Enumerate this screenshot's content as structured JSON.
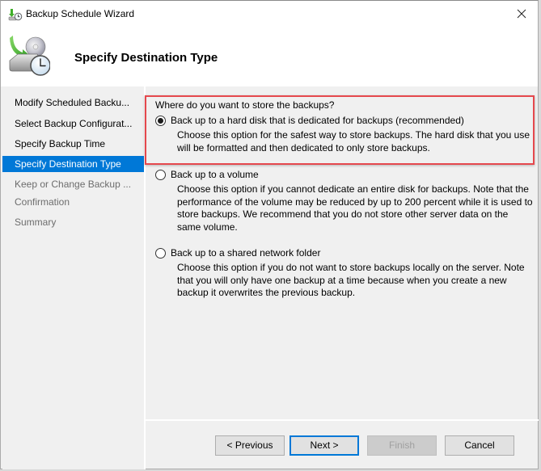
{
  "window": {
    "title": "Backup Schedule Wizard",
    "title_icon": "backup-schedule-icon",
    "close_icon": "close-icon"
  },
  "header": {
    "title": "Specify Destination Type",
    "icon": "backup-disk-clock-icon"
  },
  "sidebar": {
    "items": [
      {
        "label": "Modify Scheduled Backu...",
        "state": "done"
      },
      {
        "label": "Select Backup Configurat...",
        "state": "done"
      },
      {
        "label": "Specify Backup Time",
        "state": "done"
      },
      {
        "label": "Specify Destination Type",
        "state": "active"
      },
      {
        "label": "Keep or Change Backup ...",
        "state": "future"
      },
      {
        "label": "Confirmation",
        "state": "future"
      },
      {
        "label": "Summary",
        "state": "future"
      }
    ]
  },
  "content": {
    "question": "Where do you want to store the backups?",
    "options": [
      {
        "label": "Back up to a hard disk that is dedicated for backups (recommended)",
        "description": "Choose this option for the safest way to store backups. The hard disk that you use will be formatted and then dedicated to only store backups.",
        "selected": true
      },
      {
        "label": "Back up to a volume",
        "description": "Choose this option if you cannot dedicate an entire disk for backups. Note that the performance of the volume may be reduced by up to 200 percent while it is used to store backups. We recommend that you do not store other server data on the same volume.",
        "selected": false
      },
      {
        "label": "Back up to a shared network folder",
        "description": "Choose this option if you do not want to store backups locally on the server. Note that you will only have one backup at a time because when you create a new backup it overwrites the previous backup.",
        "selected": false
      }
    ],
    "highlight_color": "#e5484d"
  },
  "footer": {
    "previous_label": "< Previous",
    "next_label": "Next >",
    "finish_label": "Finish",
    "cancel_label": "Cancel",
    "finish_enabled": false
  },
  "colors": {
    "accent": "#0078d7",
    "background": "#f0f0f0"
  }
}
